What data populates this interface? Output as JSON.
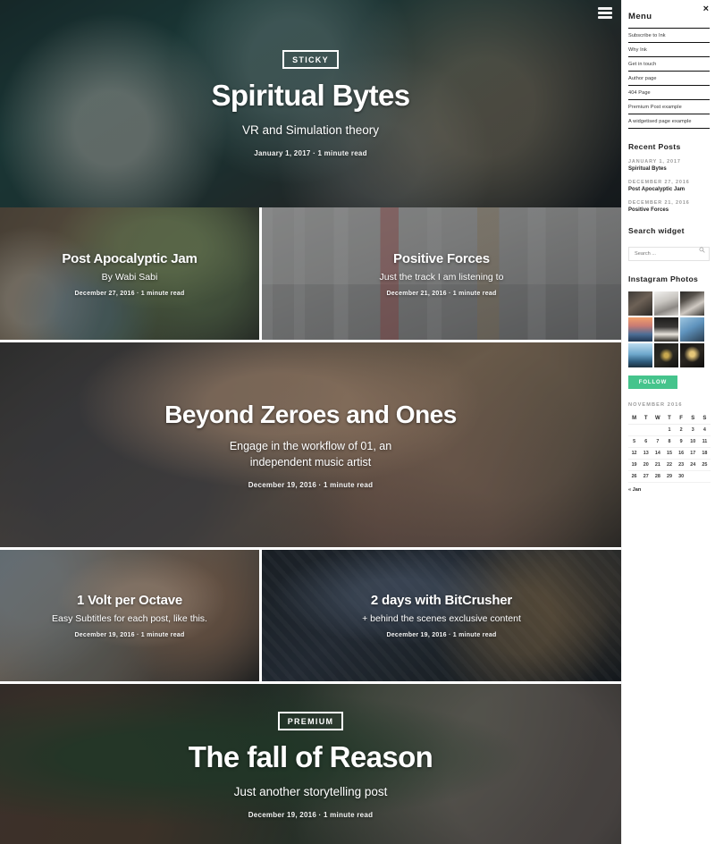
{
  "nav": {
    "hamburger_icon": "hamburger-menu-icon",
    "close_icon": "×"
  },
  "posts": {
    "hero": {
      "badge": "STICKY",
      "title": "Spiritual Bytes",
      "subtitle": "VR and Simulation theory",
      "meta": "January 1, 2017  ·  1 minute read"
    },
    "row2_left": {
      "title": "Post Apocalyptic Jam",
      "subtitle": "By Wabi Sabi",
      "meta": "December 27, 2016  ·  1 minute read"
    },
    "row2_right": {
      "title": "Positive Forces",
      "subtitle": "Just the track I am listening to",
      "meta": "December 21, 2016  ·  1 minute read"
    },
    "row3": {
      "title": "Beyond Zeroes and Ones",
      "subtitle": "Engage in the workflow of 01, an independent music artist",
      "meta": "December 19, 2016  ·  1 minute read"
    },
    "row4_left": {
      "title": "1 Volt per Octave",
      "subtitle": "Easy Subtitles for each post, like this.",
      "meta": "December 19, 2016  ·  1 minute read"
    },
    "row4_right": {
      "title": "2 days with BitCrusher",
      "subtitle": "+ behind the scenes exclusive content",
      "meta": "December 19, 2016  ·  1 minute read"
    },
    "row5": {
      "badge": "PREMIUM",
      "title": "The fall of Reason",
      "subtitle": "Just another storytelling post",
      "meta": "December 19, 2016  ·  1 minute read"
    }
  },
  "sidebar": {
    "menu_heading": "Menu",
    "menu_items": [
      {
        "label": "Subscribe to Ink"
      },
      {
        "label": "Why Ink"
      },
      {
        "label": "Get in touch"
      },
      {
        "label": "Author page"
      },
      {
        "label": "404 Page"
      },
      {
        "label": "Premium Post example"
      },
      {
        "label": "A widgetised page example"
      }
    ],
    "recent_posts": {
      "heading": "Recent Posts",
      "items": [
        {
          "date": "JANUARY 1, 2017",
          "title": "Spiritual Bytes"
        },
        {
          "date": "DECEMBER 27, 2016",
          "title": "Post Apocalyptic Jam"
        },
        {
          "date": "DECEMBER 21, 2016",
          "title": "Positive Forces"
        }
      ]
    },
    "search": {
      "heading": "Search widget",
      "placeholder": "Search ...",
      "value": "",
      "icon": "search-icon"
    },
    "instagram": {
      "heading": "Instagram Photos",
      "follow_label": "FOLLOW",
      "follow_color": "#45c48c",
      "photo_count": 9
    },
    "calendar": {
      "month_label": "NOVEMBER 2016",
      "weekdays": [
        "M",
        "T",
        "W",
        "T",
        "F",
        "S",
        "S"
      ],
      "weeks": [
        [
          "",
          "",
          "",
          "1",
          "2",
          "3",
          "4"
        ],
        [
          "5",
          "6",
          "7",
          "8",
          "9",
          "10",
          "11"
        ],
        [
          "12",
          "13",
          "14",
          "15",
          "16",
          "17",
          "18"
        ],
        [
          "19",
          "20",
          "21",
          "22",
          "23",
          "24",
          "25"
        ],
        [
          "26",
          "27",
          "28",
          "29",
          "30",
          "",
          ""
        ]
      ],
      "prev_link": "« Jan"
    }
  }
}
